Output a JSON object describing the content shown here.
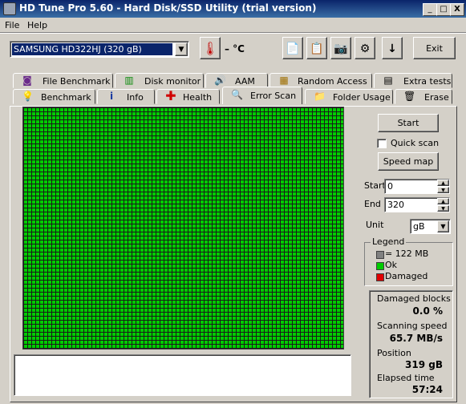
{
  "window": {
    "title": "HD Tune Pro 5.60 - Hard Disk/SSD Utility (trial version)",
    "min": "_",
    "max": "□",
    "close": "X"
  },
  "menu": {
    "file": "File",
    "help": "Help"
  },
  "toolbar": {
    "drive": "SAMSUNG HD322HJ (320 gB)",
    "temperature": "– °C",
    "exit": "Exit"
  },
  "tabs": {
    "row1": [
      "File Benchmark",
      "Disk monitor",
      "AAM",
      "Random Access",
      "Extra tests"
    ],
    "row2": [
      "Benchmark",
      "Info",
      "Health",
      "Error Scan",
      "Folder Usage",
      "Erase"
    ],
    "active": "Error Scan"
  },
  "scan": {
    "start_button": "Start",
    "quick_scan_label": "Quick scan",
    "quick_scan_checked": false,
    "speed_map_button": "Speed map",
    "start_label": "Start",
    "start_value": "0",
    "end_label": "End",
    "end_value": "320",
    "unit_label": "Unit",
    "unit_value": "gB",
    "progress_fraction": 1.0
  },
  "legend": {
    "title": "Legend",
    "block": "= 122 MB",
    "ok": "Ok",
    "damaged": "Damaged",
    "colors": {
      "block": "#808080",
      "ok": "#00cc00",
      "damaged": "#e00000"
    }
  },
  "stats": {
    "damaged_label": "Damaged blocks",
    "damaged_value": "0.0 %",
    "speed_label": "Scanning speed",
    "speed_value": "65.7 MB/s",
    "position_label": "Position",
    "position_value": "319 gB",
    "elapsed_label": "Elapsed time",
    "elapsed_value": "57:24"
  }
}
